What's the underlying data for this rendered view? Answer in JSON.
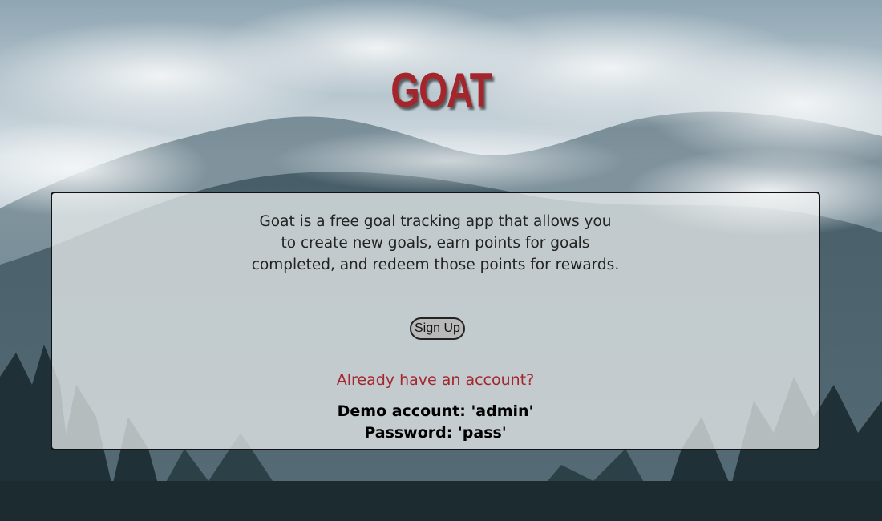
{
  "app": {
    "logo_text": "GOAT",
    "brand_color": "#a4262c",
    "background_image": "misty-forest-mountains"
  },
  "card": {
    "description": "Goat is a free goal tracking app that allows you to create new goals, earn points for goals completed, and redeem those points for rewards.",
    "signup_label": "Sign Up",
    "login_link_text": "Already have an account?",
    "demo_account": "Demo account: 'admin'",
    "demo_password": "Password: 'pass'"
  }
}
